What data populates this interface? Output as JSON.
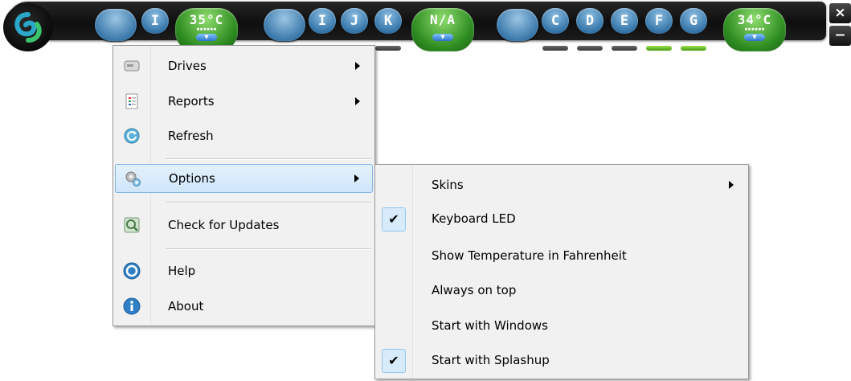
{
  "toolbar": {
    "drive_groups": [
      {
        "letters": [
          "I"
        ],
        "temperature": "35°C"
      },
      {
        "letters": [
          "I",
          "J",
          "K"
        ],
        "temperature": "N/A"
      },
      {
        "letters": [
          "C",
          "D",
          "E",
          "F",
          "G"
        ],
        "temperature": "34°C"
      }
    ],
    "close_label": "×",
    "minimize_label": "−"
  },
  "main_menu": {
    "items": [
      {
        "label": "Drives",
        "icon": "drive-icon",
        "submenu": true
      },
      {
        "label": "Reports",
        "icon": "report-icon",
        "submenu": true
      },
      {
        "label": "Refresh",
        "icon": "refresh-icon",
        "submenu": false
      },
      {
        "label": "Options",
        "icon": "gear-icon",
        "submenu": true,
        "highlighted": true
      },
      {
        "label": "Check for Updates",
        "icon": "update-icon",
        "submenu": false
      },
      {
        "label": "Help",
        "icon": "help-icon",
        "submenu": false
      },
      {
        "label": "About",
        "icon": "info-icon",
        "submenu": false
      }
    ]
  },
  "options_menu": {
    "items": [
      {
        "label": "Skins",
        "checked": false,
        "submenu": true
      },
      {
        "label": "Keyboard LED",
        "checked": true
      },
      {
        "label": "Show Temperature in Fahrenheit",
        "checked": false
      },
      {
        "label": "Always on top",
        "checked": false
      },
      {
        "label": "Start with Windows",
        "checked": false
      },
      {
        "label": "Start with Splashup",
        "checked": true
      }
    ],
    "check_glyph": "✔"
  },
  "colors": {
    "highlight": "#cfe6fa",
    "button_blue": "#3b79ab",
    "temp_green": "#2e8d21",
    "led_on": "#6cc22a"
  }
}
